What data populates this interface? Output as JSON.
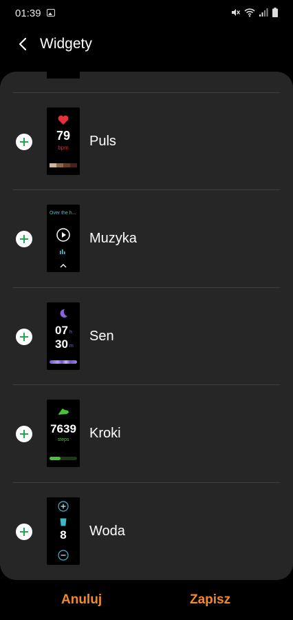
{
  "status_bar": {
    "time": "01:39",
    "icons": [
      "gallery-icon",
      "mute-icon",
      "wifi-icon",
      "signal-icon",
      "battery-icon"
    ]
  },
  "header": {
    "title": "Widgety",
    "back_icon": "chevron-left-icon"
  },
  "widgets": [
    {
      "label": "Puls",
      "preview": {
        "value": "79",
        "unit": "bpm"
      }
    },
    {
      "label": "Muzyka",
      "preview": {
        "track": "Over the h..."
      }
    },
    {
      "label": "Sen",
      "preview": {
        "hours": "07",
        "hours_unit": "h",
        "minutes": "30",
        "minutes_unit": "m"
      }
    },
    {
      "label": "Kroki",
      "preview": {
        "value": "7639",
        "unit": "steps",
        "progress": 0.4
      }
    },
    {
      "label": "Woda",
      "preview": {
        "value": "8"
      }
    }
  ],
  "footer": {
    "cancel_label": "Anuluj",
    "save_label": "Zapisz"
  },
  "colors": {
    "accent": "#f08a2c",
    "add_icon": "#1ea84a",
    "card_bg": "#262626"
  }
}
